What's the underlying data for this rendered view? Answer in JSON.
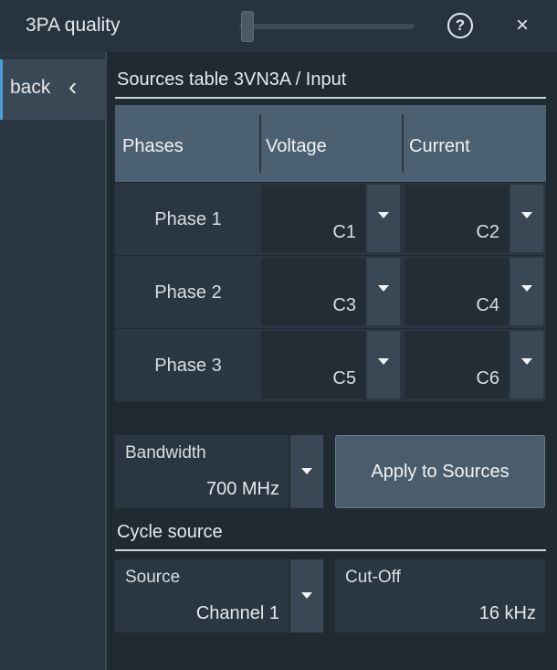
{
  "window": {
    "title": "3PA quality",
    "help_label": "?",
    "close_label": "×"
  },
  "sidebar": {
    "back_label": "back",
    "back_chevron": "‹"
  },
  "sources": {
    "section_title": "Sources table 3VN3A / Input",
    "columns": [
      "Phases",
      "Voltage",
      "Current"
    ],
    "rows": [
      {
        "phase": "Phase 1",
        "voltage": "C1",
        "current": "C2"
      },
      {
        "phase": "Phase 2",
        "voltage": "C3",
        "current": "C4"
      },
      {
        "phase": "Phase 3",
        "voltage": "C5",
        "current": "C6"
      }
    ]
  },
  "bandwidth": {
    "label": "Bandwidth",
    "value": "700 MHz"
  },
  "apply_button": {
    "label": "Apply to Sources"
  },
  "cycle_source": {
    "section_title": "Cycle source",
    "source_label": "Source",
    "source_value": "Channel 1",
    "cutoff_label": "Cut-Off",
    "cutoff_value": "16 kHz"
  },
  "icons": {
    "help": "help-icon",
    "close": "close-icon",
    "back": "chevron-left-icon",
    "dropdown": "triangle-down-icon"
  },
  "colors": {
    "background": "#1f2a33",
    "header_row": "#4b6070",
    "accent": "#4a9ed6"
  }
}
